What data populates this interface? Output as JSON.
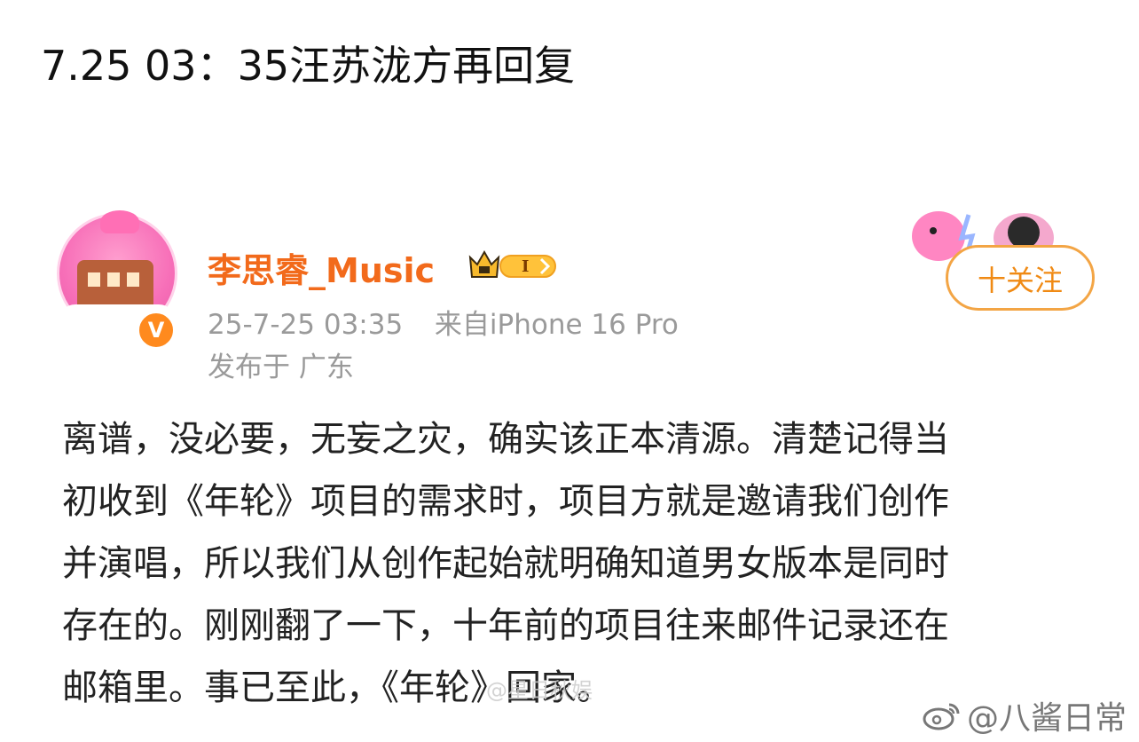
{
  "header": {
    "title": "7.25 03：35汪苏泷方再回复"
  },
  "post": {
    "username": "李思睿_Music",
    "vip_level": "I",
    "timestamp": "25-7-25 03:35",
    "source": "来自iPhone 16 Pro",
    "location": "发布于 广东",
    "verified_mark": "V",
    "follow_label": "十关注",
    "body_lines": [
      "离谱，没必要，无妄之灾，确实该正本清源。清楚记得当",
      "初收到《年轮》项目的需求时，项目方就是邀请我们创作",
      "并演唱，所以我们从创作起始就明确知道男女版本是同时",
      "存在的。刚刚翻了一下，十年前的项目往来邮件记录还在",
      "邮箱里。事已至此，《年轮》回家。"
    ],
    "inline_watermark": "@星日秋娱"
  },
  "footer": {
    "watermark_text": "@八酱日常"
  },
  "colors": {
    "username": "#f26a1b",
    "follow_border": "#f3a545",
    "meta_gray": "#9a9a9a",
    "verify_orange": "#ff8a1e"
  },
  "icons": {
    "vip": "crown-vip-icon",
    "verified": "verified-badge-icon",
    "weibo": "weibo-logo-icon"
  }
}
